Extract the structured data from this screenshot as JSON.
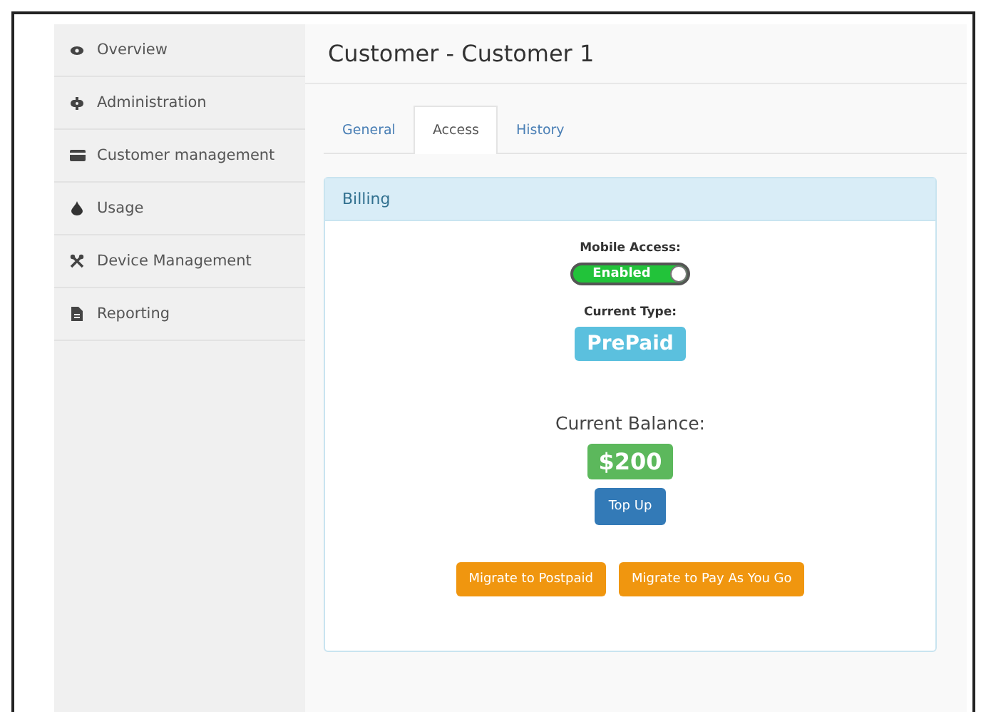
{
  "sidebar": {
    "items": [
      {
        "label": "Overview",
        "selected": false
      },
      {
        "label": "Administration",
        "selected": false
      },
      {
        "label": "Customer management",
        "selected": false
      },
      {
        "label": "Usage",
        "selected": false
      },
      {
        "label": "Device Management",
        "selected": false
      },
      {
        "label": "Reporting",
        "selected": false
      }
    ]
  },
  "page": {
    "title": "Customer - Customer 1"
  },
  "tabs": [
    {
      "label": "General",
      "selected": false
    },
    {
      "label": "Access",
      "selected": true
    },
    {
      "label": "History",
      "selected": false
    }
  ],
  "billing": {
    "title": "Billing",
    "mobile_access": {
      "label": "Mobile Access:",
      "toggle": {
        "text": "Enabled",
        "on": true
      }
    },
    "current_type": {
      "label": "Current Type:",
      "value": "PrePaid"
    },
    "current_balance": {
      "label": "Current Balance:",
      "value": "$200"
    },
    "top_up_button": "Top Up",
    "migrate_buttons": [
      "Migrate to Postpaid",
      "Migrate to Pay As You Go"
    ]
  }
}
